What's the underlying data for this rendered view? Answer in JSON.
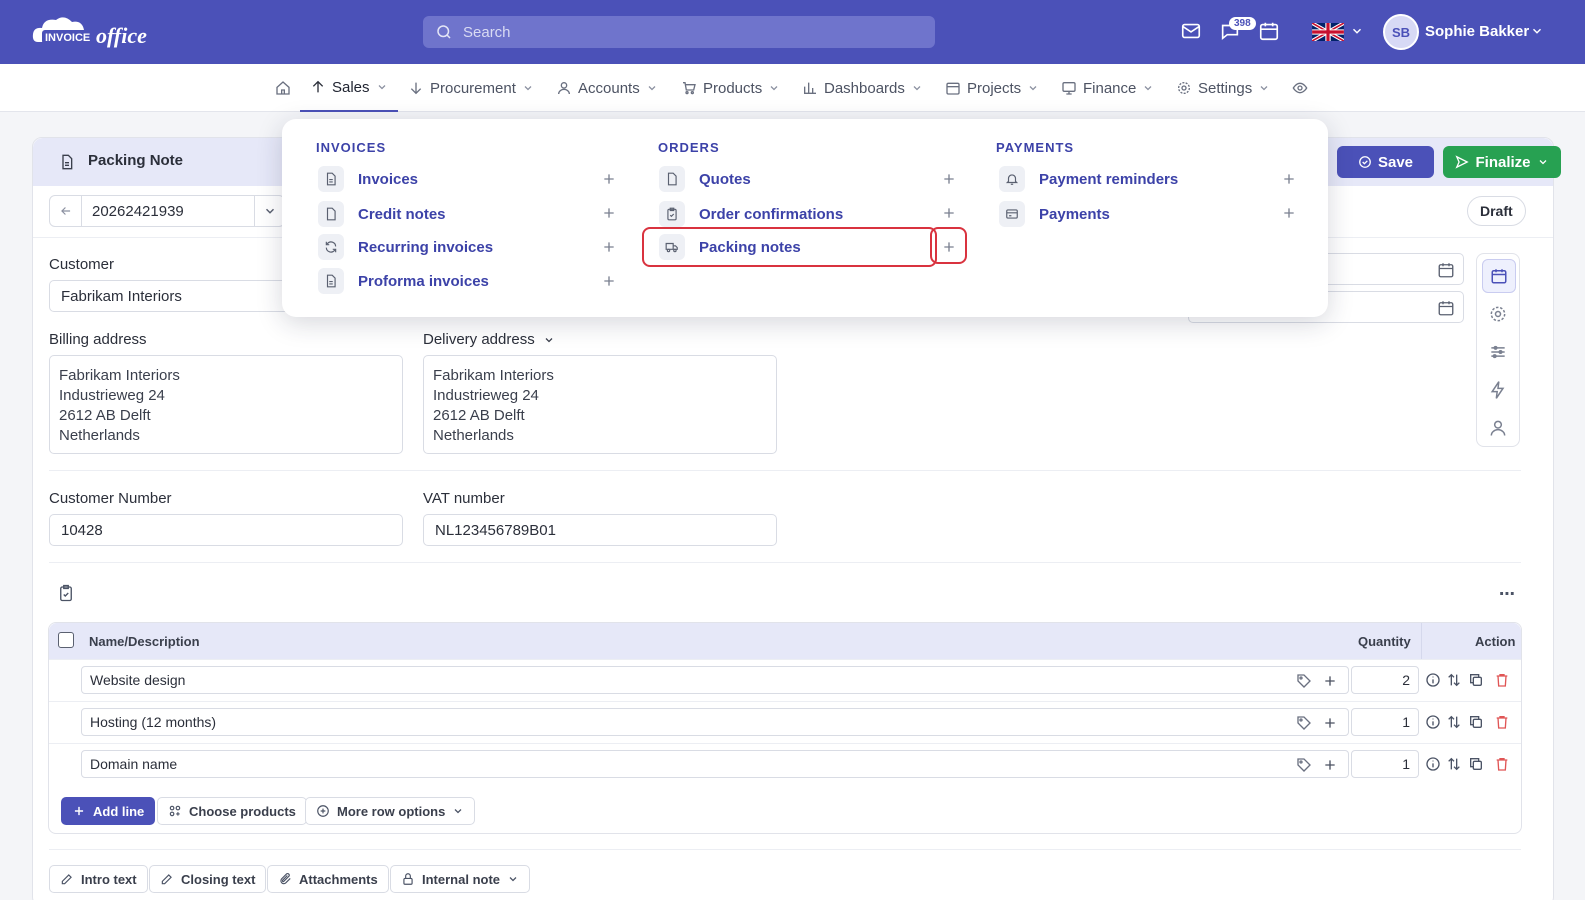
{
  "topbar": {
    "logo_text": "INVOICEoffice",
    "search_placeholder": "Search",
    "notification_count": "398",
    "user_initials": "SB",
    "user_name": "Sophie Bakker"
  },
  "nav": {
    "items": [
      {
        "label": "Sales",
        "icon": "arrow-up-icon",
        "active": true
      },
      {
        "label": "Procurement",
        "icon": "arrow-down-icon"
      },
      {
        "label": "Accounts",
        "icon": "user-icon"
      },
      {
        "label": "Products",
        "icon": "cart-icon"
      },
      {
        "label": "Dashboards",
        "icon": "bar-chart-icon"
      },
      {
        "label": "Projects",
        "icon": "calendar-icon"
      },
      {
        "label": "Finance",
        "icon": "monitor-icon"
      },
      {
        "label": "Settings",
        "icon": "gear-icon"
      }
    ]
  },
  "document": {
    "title": "Packing Note",
    "number": "20262421939",
    "status": "Draft",
    "save_label": "Save",
    "finalize_label": "Finalize"
  },
  "form": {
    "customer_label": "Customer",
    "customer_value": "Fabrikam Interiors",
    "billing_label": "Billing address",
    "billing_lines": [
      "Fabrikam Interiors",
      "Industrieweg 24",
      "2612 AB Delft",
      "Netherlands"
    ],
    "delivery_label": "Delivery address",
    "delivery_lines": [
      "Fabrikam Interiors",
      "Industrieweg 24",
      "2612 AB Delft",
      "Netherlands"
    ],
    "customer_number_label": "Customer Number",
    "customer_number_value": "10428",
    "vat_label": "VAT number",
    "vat_value": "NL123456789B01"
  },
  "lines": {
    "col_name": "Name/Description",
    "col_quantity": "Quantity",
    "col_action": "Action",
    "rows": [
      {
        "name": "Website design",
        "quantity": "2"
      },
      {
        "name": "Hosting (12 months)",
        "quantity": "1"
      },
      {
        "name": "Domain name",
        "quantity": "1"
      }
    ],
    "add_line": "Add line",
    "choose_products": "Choose products",
    "more_row_options": "More row options"
  },
  "footer_tabs": [
    "Intro text",
    "Closing text",
    "Attachments",
    "Internal note"
  ],
  "sales_menu": {
    "invoices_title": "INVOICES",
    "invoices": [
      "Invoices",
      "Credit notes",
      "Recurring invoices",
      "Proforma invoices"
    ],
    "orders_title": "ORDERS",
    "orders": [
      "Quotes",
      "Order confirmations",
      "Packing notes"
    ],
    "payments_title": "PAYMENTS",
    "payments": [
      "Payment reminders",
      "Payments"
    ]
  },
  "colors": {
    "brand": "#4b51b8",
    "success": "#27a152",
    "highlight": "#d9333f"
  }
}
